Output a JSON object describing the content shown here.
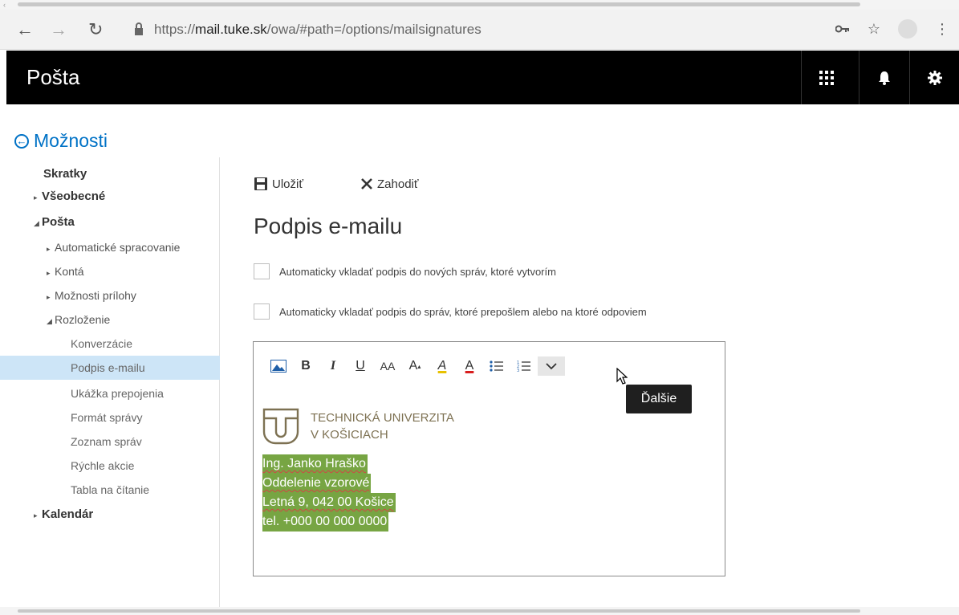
{
  "browser": {
    "url_prefix": "https://",
    "url_host": "mail.tuke.sk",
    "url_path": "/owa/#path=/options/mailsignatures"
  },
  "header": {
    "app_title": "Pošta"
  },
  "options_link": "Možnosti",
  "sidebar": {
    "items": [
      {
        "label": "Skratky"
      },
      {
        "label": "Všeobecné"
      },
      {
        "label": "Pošta"
      },
      {
        "label": "Automatické spracovanie"
      },
      {
        "label": "Kontá"
      },
      {
        "label": "Možnosti prílohy"
      },
      {
        "label": "Rozloženie"
      },
      {
        "label": "Konverzácie"
      },
      {
        "label": "Podpis e-mailu"
      },
      {
        "label": "Ukážka prepojenia"
      },
      {
        "label": "Formát správy"
      },
      {
        "label": "Zoznam správ"
      },
      {
        "label": "Rýchle akcie"
      },
      {
        "label": "Tabla na čítanie"
      },
      {
        "label": "Kalendár"
      }
    ]
  },
  "toolbar": {
    "save_label": "Uložiť",
    "discard_label": "Zahodiť"
  },
  "page_title": "Podpis e-mailu",
  "checkboxes": [
    {
      "label": "Automaticky vkladať podpis do nových správ, ktoré vytvorím",
      "checked": false
    },
    {
      "label": "Automaticky vkladať podpis do správ, ktoré prepošlem alebo na ktoré odpoviem",
      "checked": false
    }
  ],
  "editor_tools": {
    "bold": "B",
    "italic": "I",
    "underline": "U",
    "font_size": "AA",
    "grow_font": "A",
    "highlight": "A",
    "font_color": "A"
  },
  "tooltip": "Ďalšie",
  "logo": {
    "line1": "TECHNICKÁ UNIVERZITA",
    "line2": "V KOŠICIACH",
    "color": "#7d7152"
  },
  "signature": {
    "name": "Ing. Janko Hraško",
    "department": "Oddelenie vzorové",
    "address": "Letná 9, 042 00 Košice",
    "phone": "tel. +000 00 000 0000",
    "highlight_color": "#77a543"
  },
  "colors": {
    "accent": "#0072c6",
    "selected_nav": "#cde5f7",
    "header_bg": "#000000"
  }
}
